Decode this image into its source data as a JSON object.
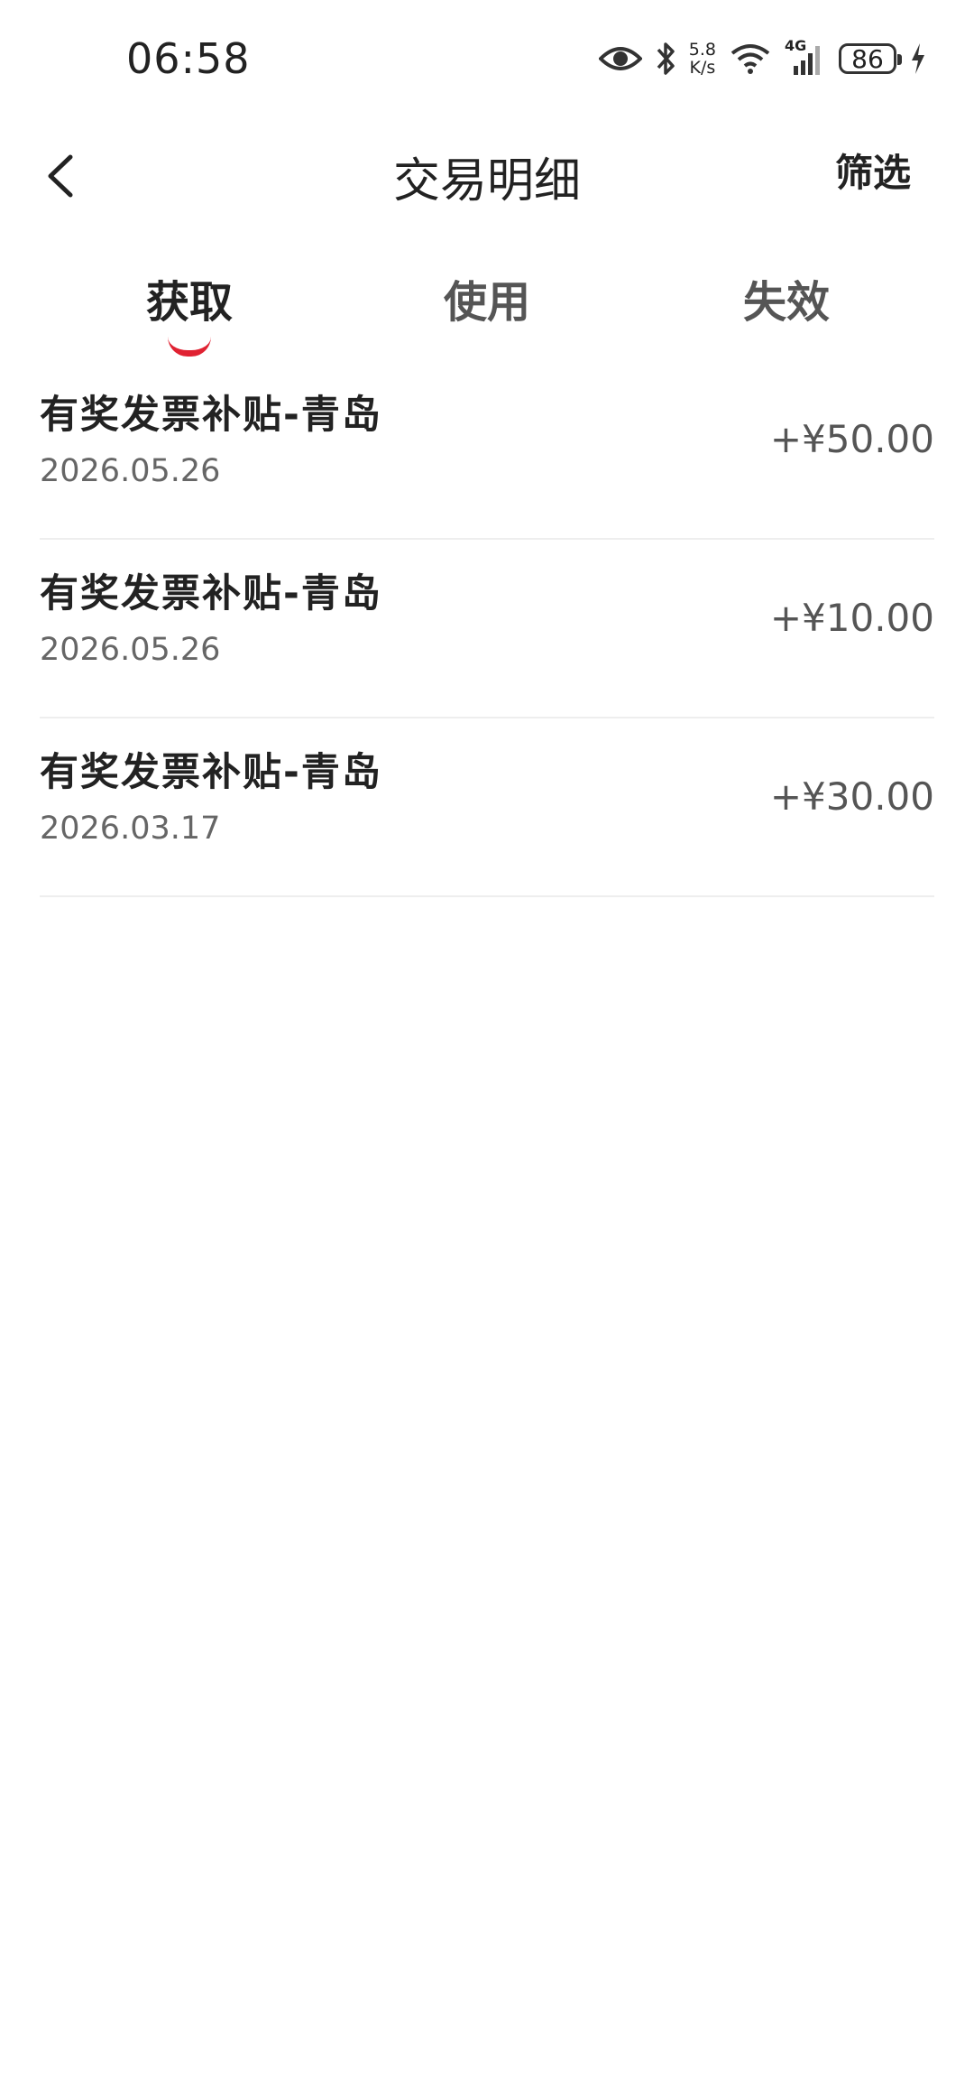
{
  "status_bar": {
    "time": "06:58",
    "net_speed_value": "5.8",
    "net_speed_unit": "K/s",
    "network_type": "4G",
    "battery_level": "86",
    "icons": [
      "eye-icon",
      "bluetooth-icon",
      "wifi-icon",
      "signal-icon",
      "battery-icon",
      "charging-icon"
    ]
  },
  "header": {
    "back_icon": "chevron-left-icon",
    "title": "交易明细",
    "filter_label": "筛选"
  },
  "tabs": [
    {
      "label": "获取",
      "active": true
    },
    {
      "label": "使用",
      "active": false
    },
    {
      "label": "失效",
      "active": false
    }
  ],
  "accent_color": "#e02232",
  "transactions": [
    {
      "title": "有奖发票补贴-青岛",
      "date": "2026.05.26",
      "amount": "+¥50.00"
    },
    {
      "title": "有奖发票补贴-青岛",
      "date": "2026.05.26",
      "amount": "+¥10.00"
    },
    {
      "title": "有奖发票补贴-青岛",
      "date": "2026.03.17",
      "amount": "+¥30.00"
    }
  ]
}
